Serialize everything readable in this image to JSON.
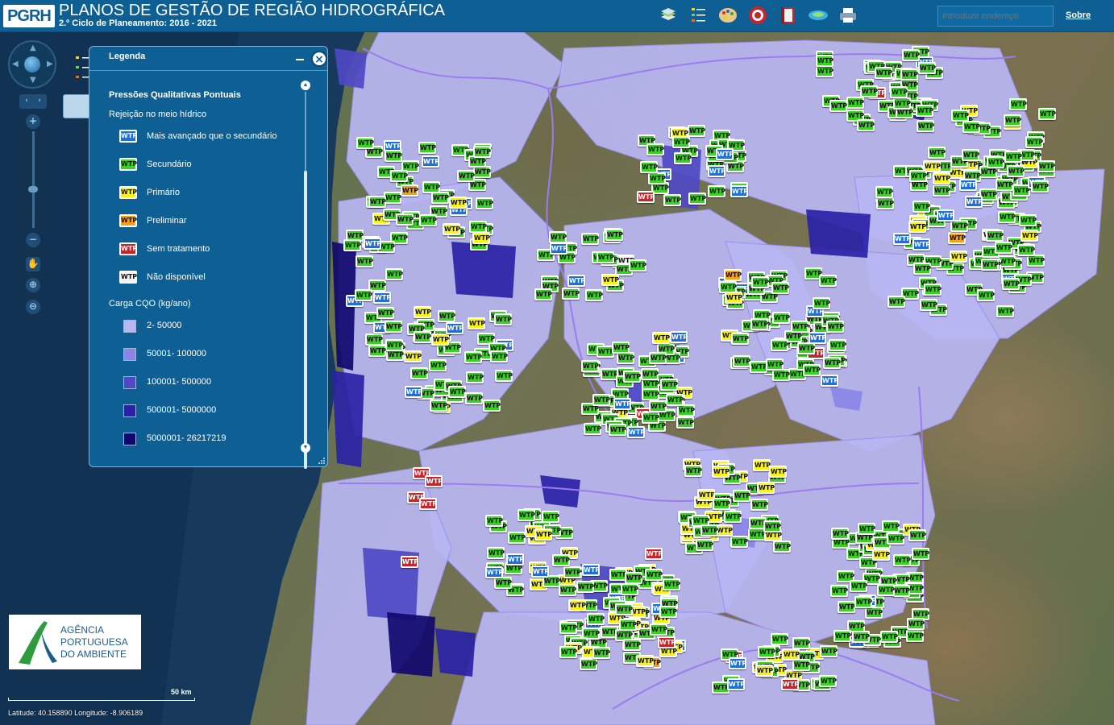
{
  "header": {
    "logo_text": "PGRH",
    "title": "PLANOS DE GESTÃO DE REGIÃO HIDROGRÁFICA",
    "subtitle": "2.º Ciclo de Planeamento: 2016 - 2021",
    "tools": [
      "layers-icon",
      "legend-icon",
      "palette-icon",
      "target-icon",
      "book-icon",
      "map-overview-icon",
      "print-icon"
    ],
    "address_placeholder": "Introduzir endereço",
    "about_label": "Sobre"
  },
  "legend": {
    "title": "Legenda",
    "section_title": "Pressões Qualitativas Pontuais",
    "subsection_title": "Rejeição no meio hídrico",
    "marker_text": "WTP",
    "treatment_items": [
      {
        "label": "Mais avançado que o secundário",
        "color": "#1e6fd9"
      },
      {
        "label": "Secundário",
        "color": "#39d123"
      },
      {
        "label": "Primário",
        "color": "#f6f21a"
      },
      {
        "label": "Preliminar",
        "color": "#f2a21a"
      },
      {
        "label": "Sem tratamento",
        "color": "#c8242b"
      },
      {
        "label": "Não disponível",
        "color": "#f2f2f2"
      }
    ],
    "load_title": "Carga CQO (kg/ano)",
    "load_items": [
      {
        "label": "2- 50000",
        "color": "#b8b6f3"
      },
      {
        "label": "50001- 100000",
        "color": "#8a86e6"
      },
      {
        "label": "100001- 500000",
        "color": "#4f49c6"
      },
      {
        "label": "500001- 5000000",
        "color": "#2a22a6"
      },
      {
        "label": "5000001- 26217219",
        "color": "#10086e"
      }
    ]
  },
  "branding": {
    "line1": "AGÊNCIA",
    "line2": "PORTUGUESA",
    "line3": "DO AMBIENTE"
  },
  "scale": {
    "label": "50 km"
  },
  "coords": {
    "text": "Latitude: 40.158890    Longitude: -8.906189"
  }
}
